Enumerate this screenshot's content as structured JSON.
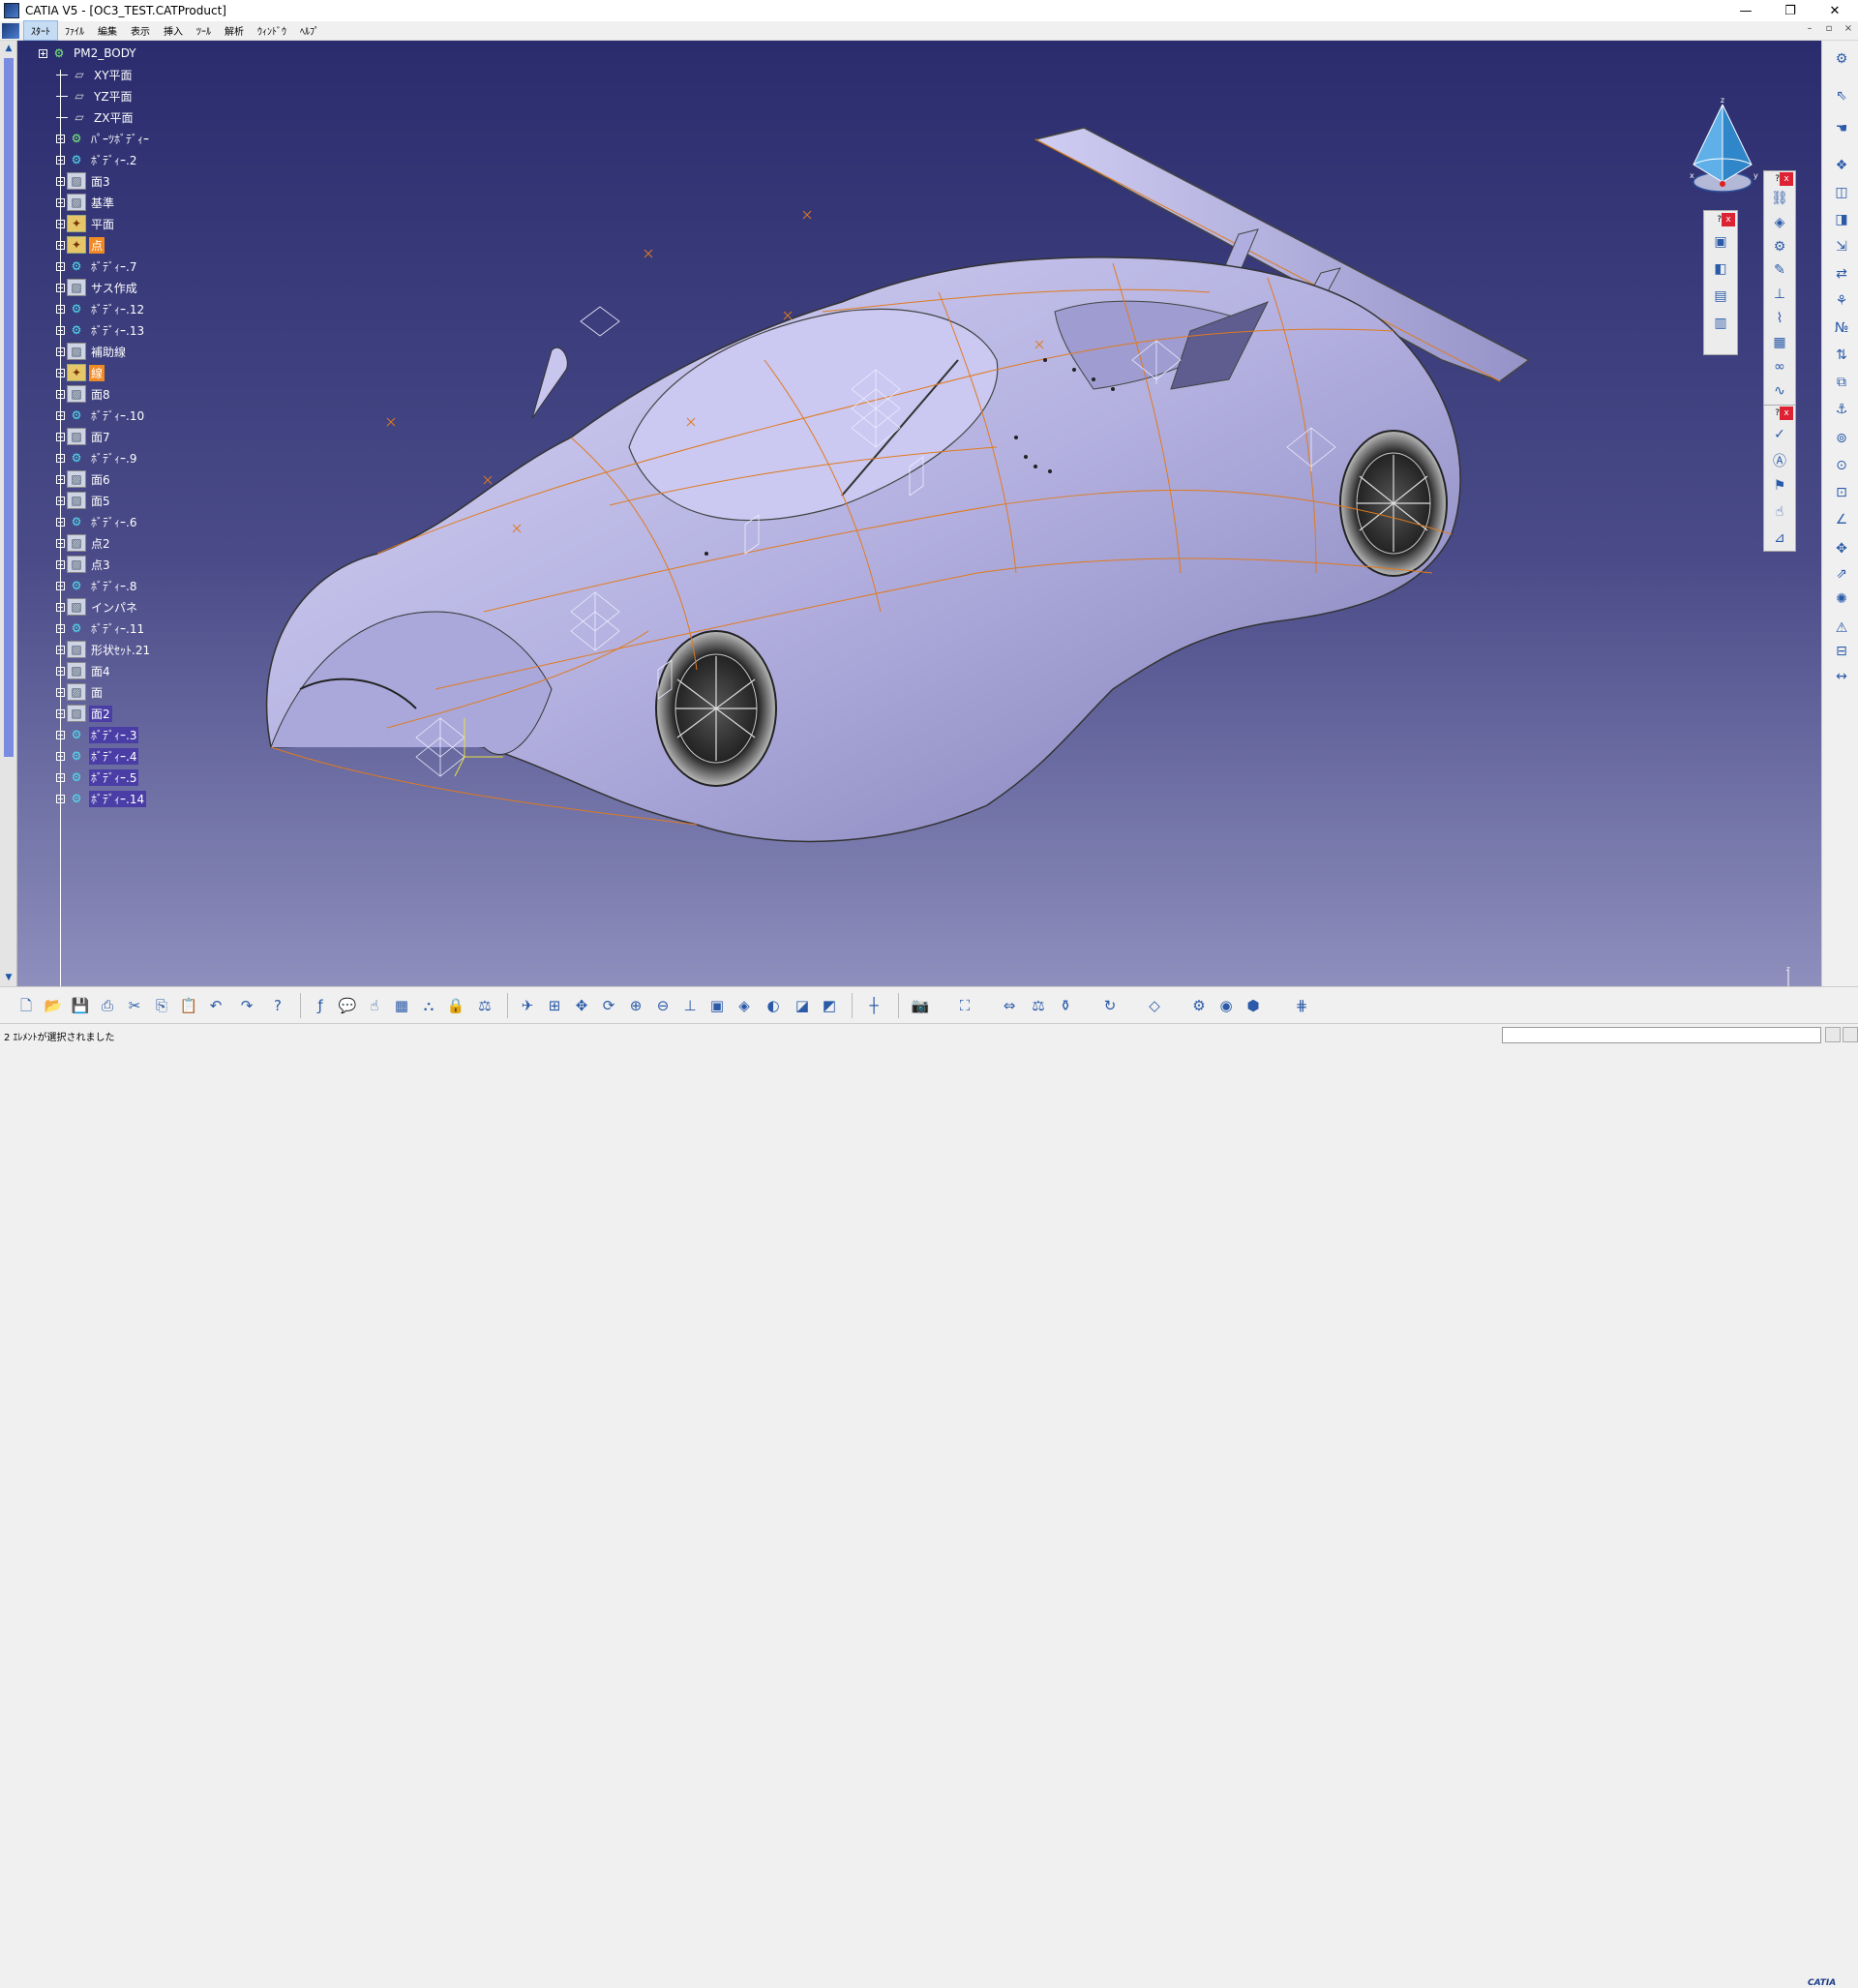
{
  "window": {
    "title": "CATIA V5 - [OC3_TEST.CATProduct]",
    "controls": {
      "minimize": "—",
      "restore": "❐",
      "close": "✕"
    }
  },
  "menu": {
    "items": [
      "ｽﾀｰﾄ",
      "ﾌｧｲﾙ",
      "編集",
      "表示",
      "挿入",
      "ﾂｰﾙ",
      "解析",
      "ｳｨﾝﾄﾞｳ",
      "ﾍﾙﾌﾟ"
    ],
    "active_index": 0,
    "doc_controls": {
      "minimize": "–",
      "restore": "▫",
      "close": "×"
    }
  },
  "tree": {
    "root": "PM2_BODY",
    "nodes": [
      {
        "label": "XY平面",
        "icon": "plane-icon",
        "expandable": false
      },
      {
        "label": "YZ平面",
        "icon": "plane-icon",
        "expandable": false
      },
      {
        "label": "ZX平面",
        "icon": "plane-icon",
        "expandable": false
      },
      {
        "label": "ﾊﾟｰﾂﾎﾞﾃﾞｨｰ",
        "icon": "gear-icon",
        "expandable": true
      },
      {
        "label": "ﾎﾞﾃﾞｨｰ.2",
        "icon": "hybrid-body-icon",
        "expandable": true
      },
      {
        "label": "面3",
        "icon": "geometrical-set-icon",
        "expandable": true
      },
      {
        "label": "基準",
        "icon": "geometrical-set-icon",
        "expandable": true
      },
      {
        "label": "平面",
        "icon": "point-set-icon",
        "expandable": true
      },
      {
        "label": "点",
        "icon": "point-set-icon",
        "expandable": true,
        "style": "orange"
      },
      {
        "label": "ﾎﾞﾃﾞｨｰ.7",
        "icon": "hybrid-body-icon",
        "expandable": true
      },
      {
        "label": "サス作成",
        "icon": "geometrical-set-icon",
        "expandable": true
      },
      {
        "label": "ﾎﾞﾃﾞｨｰ.12",
        "icon": "hybrid-body-icon",
        "expandable": true
      },
      {
        "label": "ﾎﾞﾃﾞｨｰ.13",
        "icon": "hybrid-body-icon",
        "expandable": true
      },
      {
        "label": "補助線",
        "icon": "geometrical-set-icon",
        "expandable": true
      },
      {
        "label": "線",
        "icon": "point-set-icon",
        "expandable": true,
        "style": "orange"
      },
      {
        "label": "面8",
        "icon": "geometrical-set-icon",
        "expandable": true
      },
      {
        "label": "ﾎﾞﾃﾞｨｰ.10",
        "icon": "hybrid-body-icon",
        "expandable": true
      },
      {
        "label": "面7",
        "icon": "geometrical-set-icon",
        "expandable": true
      },
      {
        "label": "ﾎﾞﾃﾞｨｰ.9",
        "icon": "hybrid-body-icon",
        "expandable": true
      },
      {
        "label": "面6",
        "icon": "geometrical-set-icon",
        "expandable": true
      },
      {
        "label": "面5",
        "icon": "geometrical-set-icon",
        "expandable": true
      },
      {
        "label": "ﾎﾞﾃﾞｨｰ.6",
        "icon": "hybrid-body-icon",
        "expandable": true
      },
      {
        "label": "点2",
        "icon": "geometrical-set-icon",
        "expandable": true
      },
      {
        "label": "点3",
        "icon": "geometrical-set-icon",
        "expandable": true
      },
      {
        "label": "ﾎﾞﾃﾞｨｰ.8",
        "icon": "hybrid-body-icon",
        "expandable": true
      },
      {
        "label": "インパネ",
        "icon": "geometrical-set-icon",
        "expandable": true
      },
      {
        "label": "ﾎﾞﾃﾞｨｰ.11",
        "icon": "hybrid-body-icon",
        "expandable": true
      },
      {
        "label": "形状ｾｯﾄ.21",
        "icon": "geometrical-set-icon",
        "expandable": true
      },
      {
        "label": "面4",
        "icon": "geometrical-set-icon",
        "expandable": true
      },
      {
        "label": "面",
        "icon": "geometrical-set-icon",
        "expandable": true
      },
      {
        "label": "面2",
        "icon": "geometrical-set-icon",
        "expandable": true
      },
      {
        "label": "ﾎﾞﾃﾞｨｰ.3",
        "icon": "hybrid-body-icon",
        "expandable": true
      },
      {
        "label": "ﾎﾞﾃﾞｨｰ.4",
        "icon": "hybrid-body-icon",
        "expandable": true
      },
      {
        "label": "ﾎﾞﾃﾞｨｰ.5",
        "icon": "hybrid-body-icon",
        "expandable": true
      },
      {
        "label": "ﾎﾞﾃﾞｨｰ.14",
        "icon": "hybrid-body-icon",
        "expandable": true
      }
    ]
  },
  "floating_toolbars": [
    {
      "caption": "?",
      "close": "x"
    },
    {
      "caption": "?",
      "close": "x"
    },
    {
      "caption": "?",
      "close": "x"
    }
  ],
  "compass_labels": {
    "z": "z",
    "x": "x",
    "y": "y"
  },
  "status": {
    "message": "2 ｴﾚﾒﾝﾄが選択されました"
  },
  "logo": {
    "text": "CATIA"
  },
  "colors": {
    "viewport_top": "#2a2c6e",
    "viewport_bottom": "#8e8fbd",
    "wireframe": "#e07a1e",
    "body_surface": "#b9b6e6",
    "selection": "#4a3ea6",
    "highlight": "#f08a24"
  }
}
